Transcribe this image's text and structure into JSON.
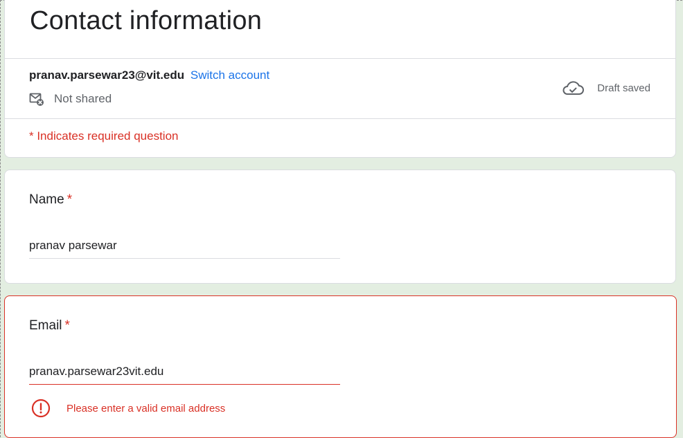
{
  "form": {
    "title": "Contact information",
    "account": {
      "email": "pranav.parsewar23@vit.edu",
      "switch_label": "Switch account",
      "shared_status": "Not shared",
      "draft_status": "Draft saved"
    },
    "required_note": "* Indicates required question"
  },
  "questions": [
    {
      "label": "Name",
      "required_marker": "*",
      "answer": "pranav parsewar"
    },
    {
      "label": "Email",
      "required_marker": "*",
      "answer": "pranav.parsewar23vit.edu",
      "error": "Please enter a valid email address"
    }
  ],
  "colors": {
    "background": "#e3eee1",
    "error": "#d93025",
    "link": "#1a73e8"
  },
  "icons": {
    "not_shared": "mail-not-shared-icon",
    "draft": "cloud-check-icon",
    "error": "error-icon"
  }
}
